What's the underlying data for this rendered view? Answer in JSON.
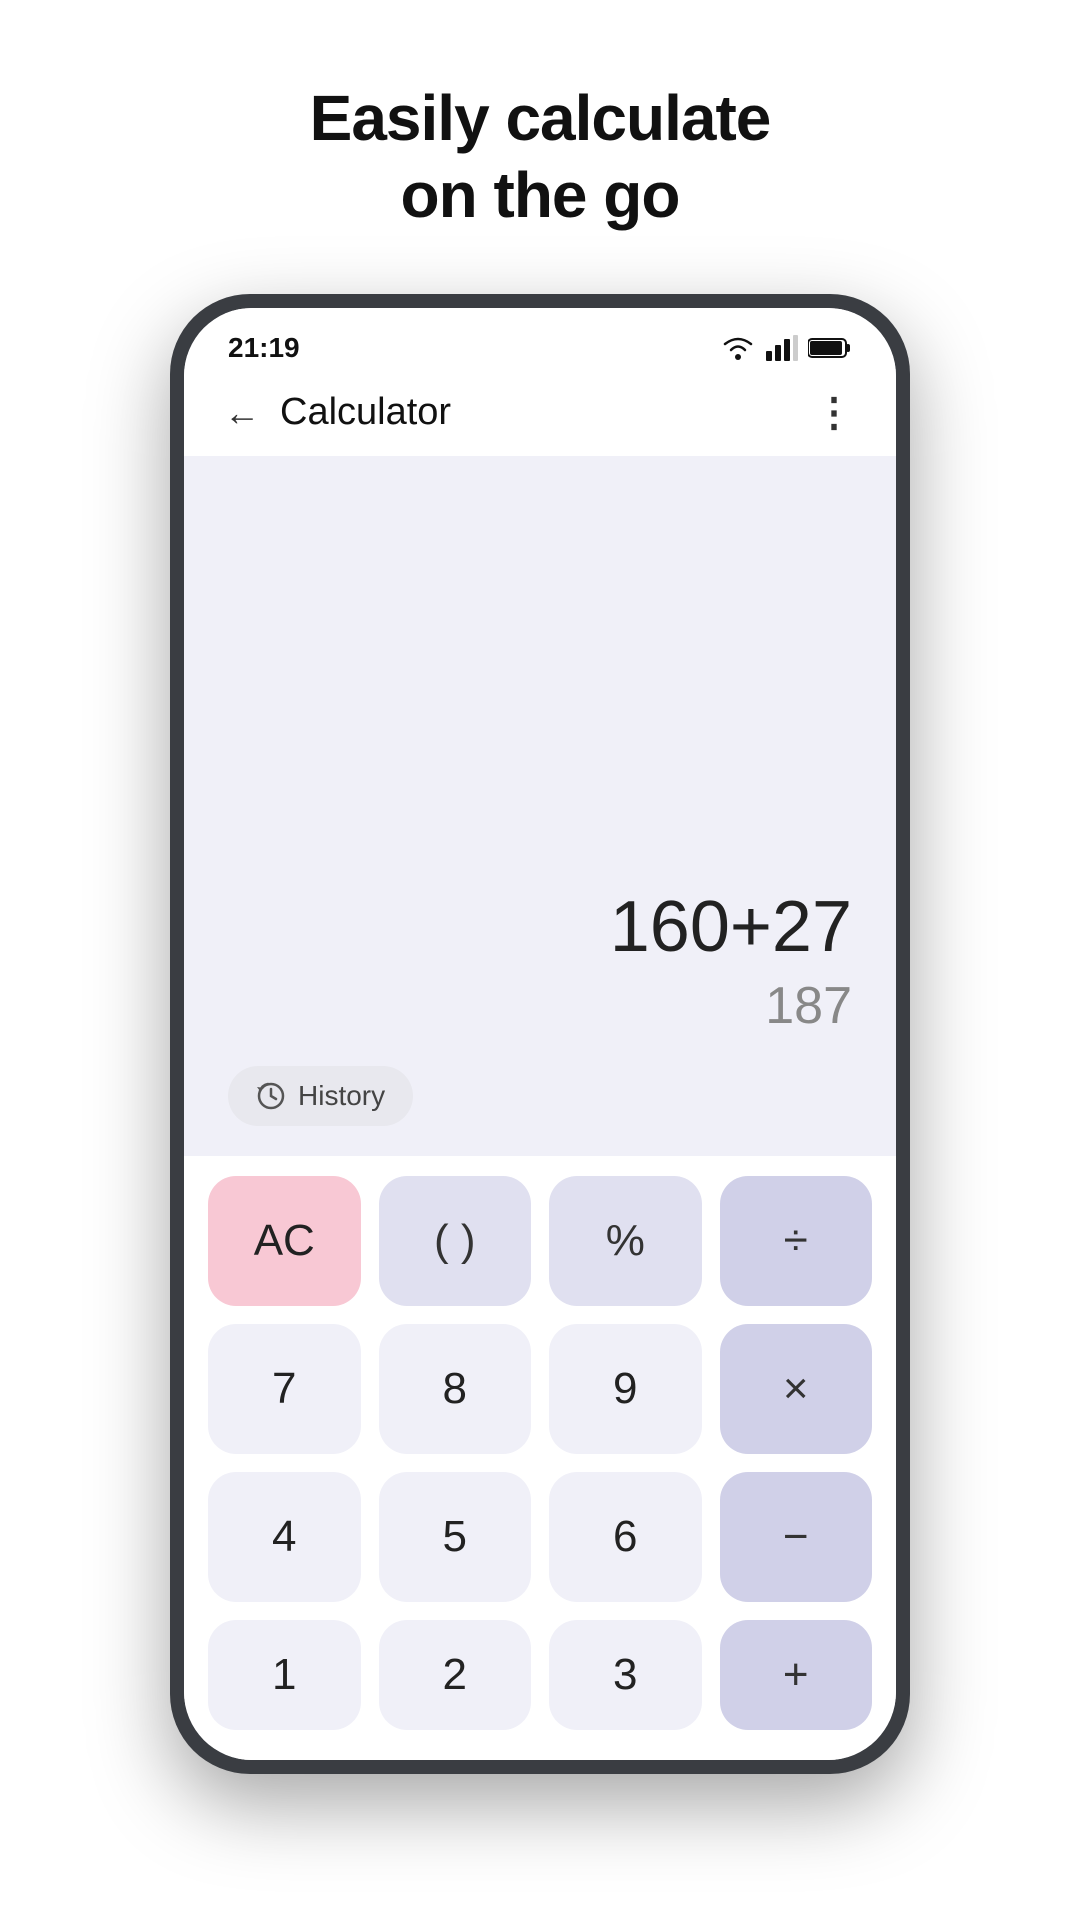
{
  "page": {
    "headline_line1": "Easily calculate",
    "headline_line2": "on the go"
  },
  "status_bar": {
    "time": "21:19"
  },
  "app_bar": {
    "title": "Calculator",
    "back_label": "←",
    "more_label": "⋮"
  },
  "display": {
    "expression": "160+27",
    "result": "187"
  },
  "history_button": {
    "label": "History"
  },
  "keypad": {
    "rows": [
      [
        {
          "label": "AC",
          "type": "ac"
        },
        {
          "label": "( )",
          "type": "operator"
        },
        {
          "label": "%",
          "type": "operator"
        },
        {
          "label": "÷",
          "type": "operator-strong"
        }
      ],
      [
        {
          "label": "7",
          "type": "number"
        },
        {
          "label": "8",
          "type": "number"
        },
        {
          "label": "9",
          "type": "number"
        },
        {
          "label": "×",
          "type": "operator-strong"
        }
      ],
      [
        {
          "label": "4",
          "type": "number"
        },
        {
          "label": "5",
          "type": "number"
        },
        {
          "label": "6",
          "type": "number"
        },
        {
          "label": "−",
          "type": "operator-strong"
        }
      ]
    ],
    "partial_row": [
      {
        "label": "1",
        "type": "number"
      },
      {
        "label": "2",
        "type": "number"
      },
      {
        "label": "3",
        "type": "number"
      },
      {
        "label": "+",
        "type": "operator-strong"
      }
    ]
  }
}
